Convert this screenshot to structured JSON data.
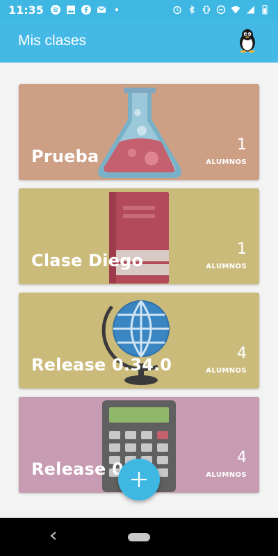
{
  "status_bar": {
    "time": "11:35",
    "left_icons": [
      "spotify-icon",
      "image-icon",
      "facebook-icon",
      "gmail-icon",
      "dot-icon"
    ],
    "right_icons": [
      "alarm-icon",
      "bluetooth-icon",
      "vibrate-icon",
      "do-not-disturb-icon",
      "wifi-icon",
      "signal-icon",
      "battery-icon"
    ]
  },
  "app_bar": {
    "title": "Mis clases",
    "avatar_icon": "penguin-avatar-icon",
    "color": "#44b9e6"
  },
  "classes": [
    {
      "name": "Prueba",
      "count": "1",
      "count_label": "ALUMNOS",
      "color": "#cd9f85",
      "icon": "flask-icon"
    },
    {
      "name": "Clase Diego",
      "count": "1",
      "count_label": "ALUMNOS",
      "color": "#cbbb7b",
      "icon": "book-icon"
    },
    {
      "name": "Release 0.34.0",
      "count": "4",
      "count_label": "ALUMNOS",
      "color": "#cbbb7b",
      "icon": "globe-icon"
    },
    {
      "name": "Release 0.",
      "count": "4",
      "count_label": "ALUMNOS",
      "color": "#c79bb1",
      "icon": "calculator-icon"
    }
  ],
  "fab": {
    "icon": "plus-icon",
    "color": "#3eb7e3"
  },
  "nav_bar": {
    "back_icon": "back-icon",
    "home_icon": "home-pill-icon"
  }
}
